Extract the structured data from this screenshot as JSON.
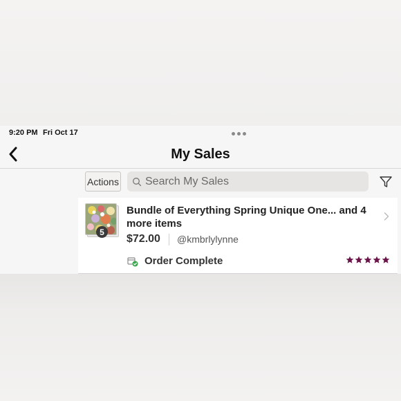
{
  "status_bar": {
    "time": "9:20 PM",
    "date": "Fri Oct 17"
  },
  "header": {
    "title": "My Sales",
    "back_icon": "chevron-left-icon"
  },
  "toolbar": {
    "actions_label": "Actions",
    "search_placeholder": "Search My Sales",
    "search_value": "",
    "filter_icon": "filter-icon"
  },
  "sales": [
    {
      "title": "Bundle of Everything Spring Unique One... and 4 more items",
      "item_count": "5",
      "price": "$72.00",
      "buyer": "@kmbrlylynne",
      "status": "Order Complete",
      "rating": 5
    }
  ],
  "colors": {
    "star": "#6b1449",
    "status_check": "#3aa54a"
  }
}
